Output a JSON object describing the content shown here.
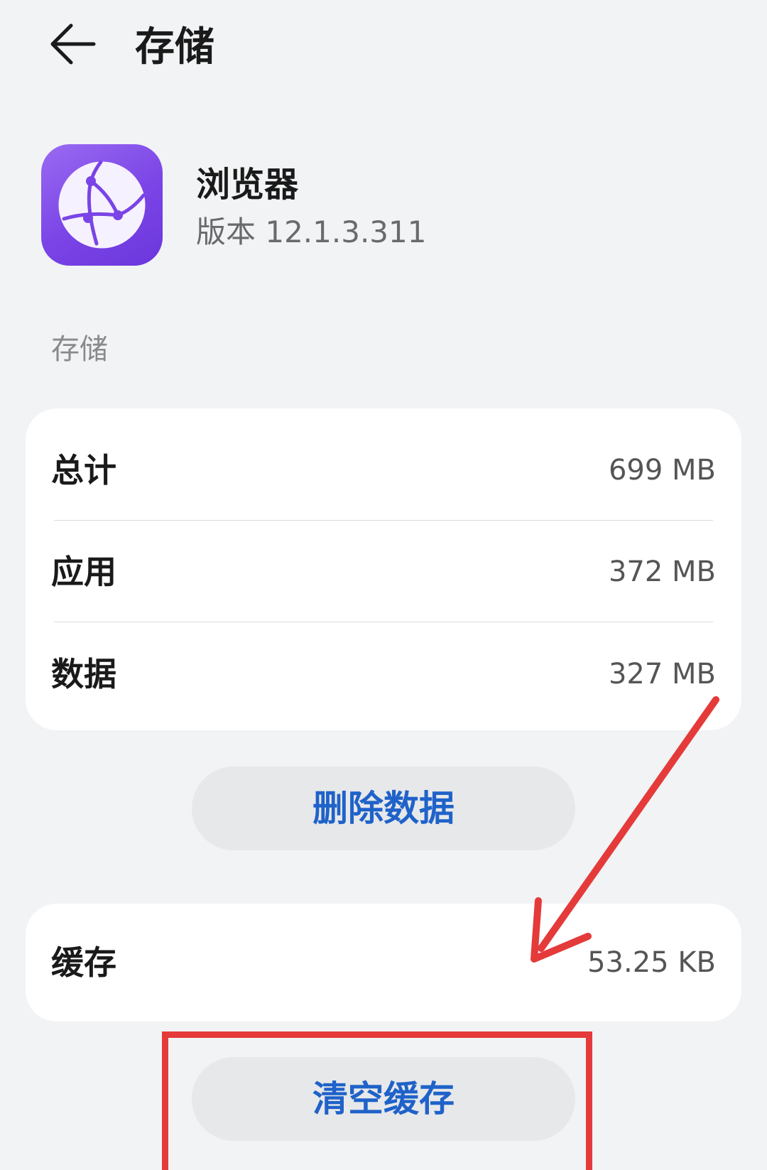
{
  "header": {
    "title": "存储",
    "back_icon": "arrow-left-icon"
  },
  "app": {
    "name": "浏览器",
    "version": "版本 12.1.3.311",
    "icon": "browser-globe-icon",
    "icon_color": "#7a44e6"
  },
  "storage_section": {
    "label": "存储",
    "rows": [
      {
        "label": "总计",
        "value": "699 MB"
      },
      {
        "label": "应用",
        "value": "372 MB"
      },
      {
        "label": "数据",
        "value": "327 MB"
      }
    ]
  },
  "delete_button": {
    "label": "删除数据"
  },
  "cache": {
    "label": "缓存",
    "value": "53.25 KB"
  },
  "clear_button": {
    "label": "清空缓存"
  },
  "colors": {
    "accent": "#1f62c9",
    "annotation": "#e53a3a",
    "background": "#f1f3f5"
  }
}
